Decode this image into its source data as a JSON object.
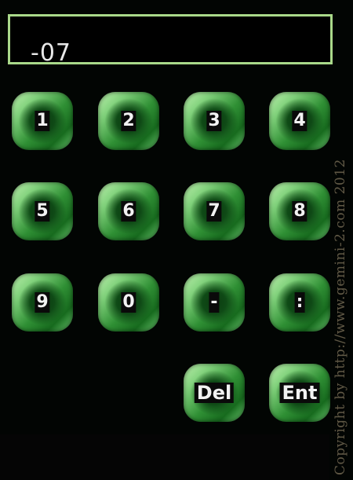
{
  "display": {
    "value": "-07"
  },
  "keypad": {
    "rows": [
      [
        "1",
        "2",
        "3",
        "4"
      ],
      [
        "5",
        "6",
        "7",
        "8"
      ],
      [
        "9",
        "0",
        "-",
        ":"
      ]
    ],
    "delete_label": "Del",
    "enter_label": "Ent"
  },
  "watermark": "Copyright by http://www.gemini-2.com 2012",
  "colors": {
    "display_border": "#a9d98a",
    "key_green": "#3fa846",
    "key_center": "#0b3a10",
    "background": "#020503"
  }
}
